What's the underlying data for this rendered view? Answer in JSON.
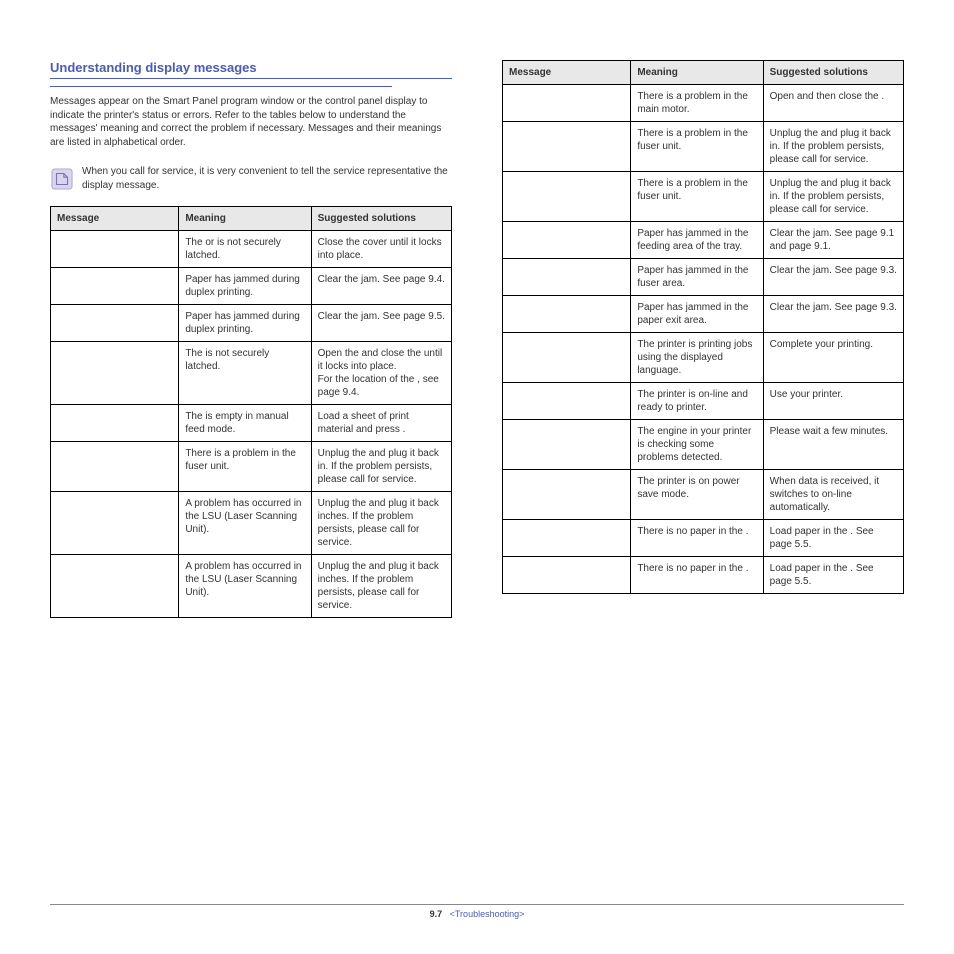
{
  "section_title": "Understanding display messages",
  "subsection_title": "",
  "intro": "Messages appear on the Smart Panel program window or the control panel display to indicate the printer's status or errors. Refer to the tables below to understand the messages' meaning and correct the problem if necessary. Messages and their meanings are listed in alphabetical order.",
  "note": "When you call for service, it is very convenient to tell the service representative the display message.",
  "headers": {
    "msg": "Message",
    "mean": "Meaning",
    "sol": "Suggested solutions"
  },
  "left_rows": [
    {
      "msg": "",
      "mean": "The            or            is not securely latched.",
      "sol": "Close the cover until it locks into place."
    },
    {
      "msg": "",
      "mean": "Paper has jammed during duplex printing.",
      "sol": "Clear the jam. See page 9.4."
    },
    {
      "msg": "",
      "mean": "Paper has jammed during duplex printing.",
      "sol": "Clear the jam. See page 9.5."
    },
    {
      "msg": "",
      "mean": "The                is not securely latched.",
      "sol": "Open the            and close the            until it locks into place.\nFor the location of the                 , see page 9.4."
    },
    {
      "msg": "",
      "mean": "The            is empty in manual feed mode.",
      "sol": "Load a sheet of print material and press            ."
    },
    {
      "msg": "",
      "mean": "There is a problem in the fuser unit.",
      "sol": "Unplug the            and plug it back in. If the problem persists, please call for service."
    },
    {
      "msg": "",
      "mean": "A problem has occurred in the LSU (Laser Scanning Unit).",
      "sol": "Unplug the            and plug it back inches. If the problem persists, please call for service."
    },
    {
      "msg": "",
      "mean": "A problem has occurred in the LSU (Laser Scanning Unit).",
      "sol": "Unplug the            and plug it back inches. If the problem persists, please call for service."
    }
  ],
  "right_rows": [
    {
      "msg": "",
      "mean": "There is a problem in the main motor.",
      "sol": "Open and then close the            ."
    },
    {
      "msg": "",
      "mean": "There is a problem in the fuser unit.",
      "sol": "Unplug the            and plug it back in. If the problem persists, please call for service."
    },
    {
      "msg": "",
      "mean": "There is a problem in the fuser unit.",
      "sol": "Unplug the            and plug it back in. If the problem persists, please call for service."
    },
    {
      "msg": "",
      "mean": "Paper has jammed in the feeding area of the tray.",
      "sol": "Clear the jam. See page 9.1 and page 9.1."
    },
    {
      "msg": "",
      "mean": "Paper has jammed in the fuser area.",
      "sol": "Clear the jam. See page 9.3."
    },
    {
      "msg": "",
      "mean": "Paper has jammed in the paper exit area.",
      "sol": "Clear the jam. See page 9.3."
    },
    {
      "msg": "",
      "mean": "The printer is printing jobs using the displayed language.",
      "sol": "Complete your printing."
    },
    {
      "msg": "",
      "mean": "The printer is on-line and ready to printer.",
      "sol": "Use your printer."
    },
    {
      "msg": "",
      "mean": "The engine in your printer is checking some problems detected.",
      "sol": "Please wait a few minutes."
    },
    {
      "msg": "",
      "mean": "The printer is on power save mode.",
      "sol": "When data is received, it switches to on-line automatically."
    },
    {
      "msg": "",
      "mean": "There is no paper in the            .",
      "sol": "Load paper in the            . See page 5.5."
    },
    {
      "msg": "",
      "mean": "There is no paper in the            .",
      "sol": "Load paper in the            . See page 5.5."
    }
  ],
  "footer": {
    "pagenum": "9.7",
    "section": "<Troubleshooting>"
  }
}
